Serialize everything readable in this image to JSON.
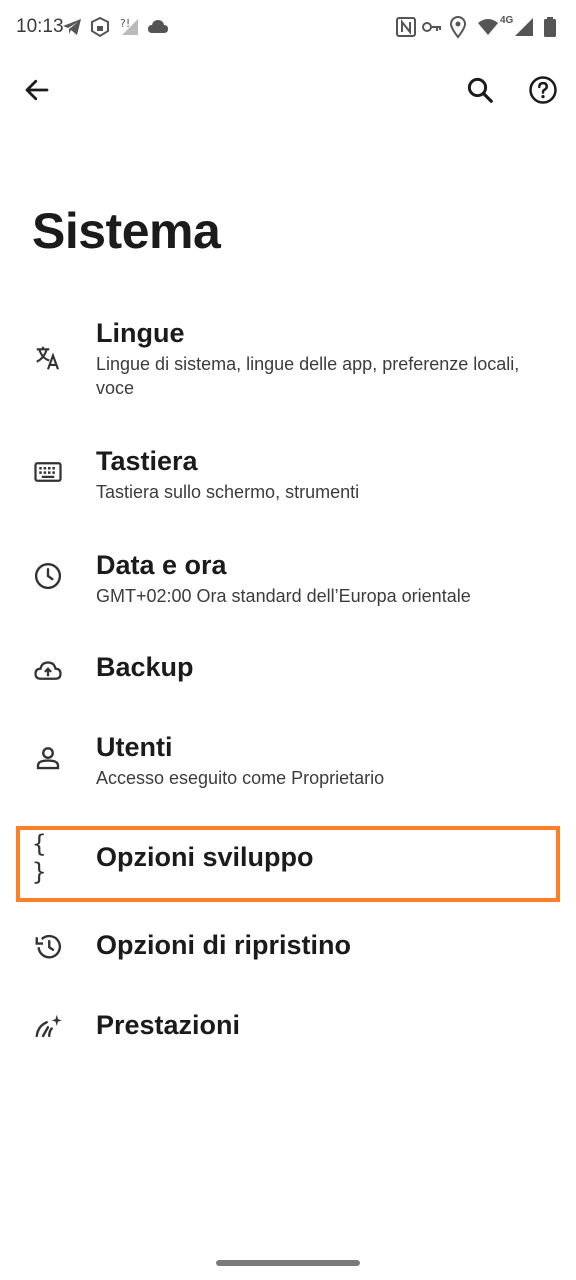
{
  "status_bar": {
    "time": "10:13",
    "network_label": "4G"
  },
  "top_bar": {
    "back_icon": "arrow-back-icon",
    "search_icon": "search-icon",
    "help_icon": "help-icon"
  },
  "page": {
    "title": "Sistema"
  },
  "items": [
    {
      "icon": "translate-icon",
      "title": "Lingue",
      "subtitle": "Lingue di sistema, lingue delle app, preferenze locali, voce"
    },
    {
      "icon": "keyboard-icon",
      "title": "Tastiera",
      "subtitle": "Tastiera sullo schermo, strumenti"
    },
    {
      "icon": "clock-icon",
      "title": "Data e ora",
      "subtitle": "GMT+02:00 Ora standard dell’Europa orientale"
    },
    {
      "icon": "cloud-upload-icon",
      "title": "Backup",
      "subtitle": ""
    },
    {
      "icon": "person-icon",
      "title": "Utenti",
      "subtitle": "Accesso eseguito come Proprietario"
    },
    {
      "icon": "braces-icon",
      "title": "Opzioni sviluppo",
      "subtitle": "",
      "icon_text": "{ }"
    },
    {
      "icon": "restore-icon",
      "title": "Opzioni di ripristino",
      "subtitle": ""
    },
    {
      "icon": "performance-icon",
      "title": "Prestazioni",
      "subtitle": ""
    }
  ],
  "highlight_color": "#ff7f26"
}
